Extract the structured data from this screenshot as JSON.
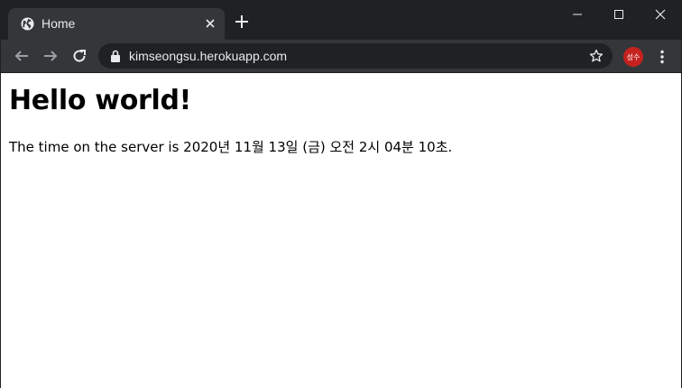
{
  "browser": {
    "tab": {
      "title": "Home",
      "favicon": "globe-icon"
    },
    "omnibox": {
      "url": "kimseongsu.herokuapp.com"
    },
    "profile": {
      "initials": "성수",
      "color": "#c5221f"
    },
    "icons": [
      "back-icon",
      "forward-icon",
      "reload-icon",
      "lock-icon",
      "star-icon",
      "new-tab-icon",
      "kebab-menu-icon",
      "minimize-icon",
      "maximize-icon",
      "close-icon"
    ]
  },
  "page": {
    "heading": "Hello world!",
    "server_time": "The time on the server is 2020년 11월 13일 (금) 오전 2시 04분 10초."
  }
}
